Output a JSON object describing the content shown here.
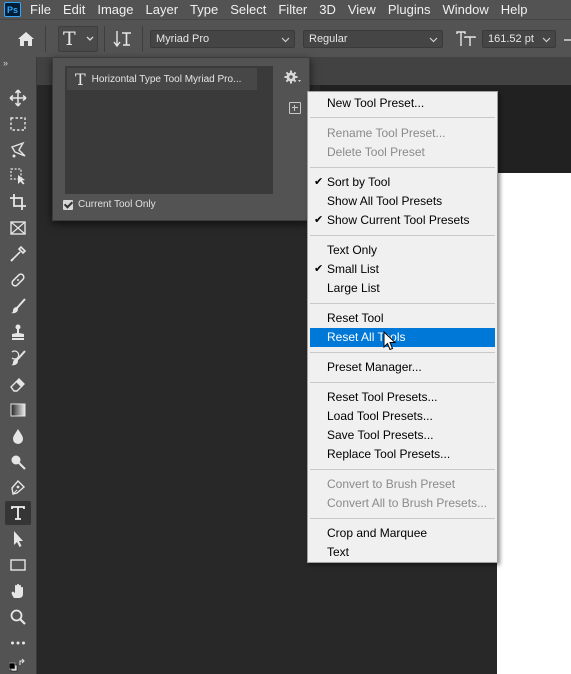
{
  "app": {
    "logo_text": "Ps"
  },
  "menubar": {
    "items": [
      "File",
      "Edit",
      "Image",
      "Layer",
      "Type",
      "Select",
      "Filter",
      "3D",
      "View",
      "Plugins",
      "Window",
      "Help"
    ]
  },
  "options": {
    "font_family": "Myriad Pro",
    "font_style": "Regular",
    "font_size": "161.52 pt"
  },
  "preset_panel": {
    "item_label": "Horizontal Type Tool Myriad Pro...",
    "current_tool_only_label": "Current Tool Only",
    "current_tool_only_checked": true
  },
  "context_menu": {
    "items": [
      {
        "label": "New Tool Preset...",
        "enabled": true,
        "checked": false
      },
      {
        "label": "Rename Tool Preset...",
        "enabled": false,
        "checked": false
      },
      {
        "label": "Delete Tool Preset",
        "enabled": false,
        "checked": false
      },
      {
        "label": "Sort by Tool",
        "enabled": true,
        "checked": true
      },
      {
        "label": "Show All Tool Presets",
        "enabled": true,
        "checked": false
      },
      {
        "label": "Show Current Tool Presets",
        "enabled": true,
        "checked": true
      },
      {
        "label": "Text Only",
        "enabled": true,
        "checked": false
      },
      {
        "label": "Small List",
        "enabled": true,
        "checked": true
      },
      {
        "label": "Large List",
        "enabled": true,
        "checked": false
      },
      {
        "label": "Reset Tool",
        "enabled": true,
        "checked": false
      },
      {
        "label": "Reset All Tools",
        "enabled": true,
        "checked": false,
        "highlighted": true
      },
      {
        "label": "Preset Manager...",
        "enabled": true,
        "checked": false
      },
      {
        "label": "Reset Tool Presets...",
        "enabled": true,
        "checked": false
      },
      {
        "label": "Load Tool Presets...",
        "enabled": true,
        "checked": false
      },
      {
        "label": "Save Tool Presets...",
        "enabled": true,
        "checked": false
      },
      {
        "label": "Replace Tool Presets...",
        "enabled": true,
        "checked": false
      },
      {
        "label": "Convert to Brush Preset",
        "enabled": false,
        "checked": false
      },
      {
        "label": "Convert All to Brush Presets...",
        "enabled": false,
        "checked": false
      },
      {
        "label": "Crop and Marquee",
        "enabled": true,
        "checked": false
      },
      {
        "label": "Text",
        "enabled": true,
        "checked": false
      }
    ],
    "check_glyph": "✔"
  },
  "colors": {
    "highlight": "#0078d7",
    "menu_bg": "#f0f0f0",
    "chrome": "#535353"
  }
}
